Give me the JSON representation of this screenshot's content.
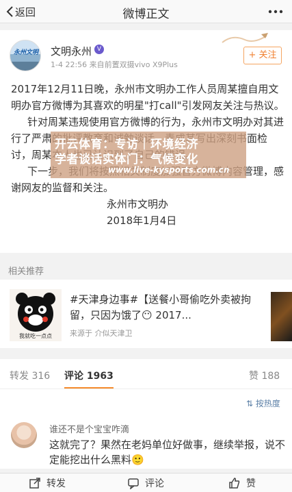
{
  "nav": {
    "back_label": "返回",
    "title": "微博正文"
  },
  "author": {
    "name": "文明永州",
    "avatar_text": "永州文明",
    "verified": "V",
    "meta": "1-4 22:56  来自前置双摄vivo X9Plus",
    "follow_label": "+ 关注"
  },
  "post": {
    "para1": "2017年12月11日晚，永州市文明办工作人员周某擅自用文明办官方微博为其喜欢的明星\"打call\"引发网友关注与热议。",
    "para2": "针对周某违规使用官方微博的行为，永州市文明办对其进行了严肃的批评教育和诚勉谈话，责成其写出深刻书面检讨，周某本人也已认识到了自己的错误。",
    "para3": "下一步，我们将按照相关制度加强官方微博内容管理，感谢网友的监督和关注。",
    "sign": "永州市文明办",
    "date": "2018年1月4日"
  },
  "watermark": {
    "line1": "开云体育：专访｜环境经济",
    "line2": "学者谈话实体门：气候变化",
    "line3": "www.live-kysports.com.cn"
  },
  "related": {
    "section_title": "相关推荐",
    "thumb_caption": "我就吃一点点",
    "text": "#天津身边事#【送餐小哥偷吃外卖被拘留，只因为饿了😶 2017...",
    "source": "来源于  介似天津卫"
  },
  "tabs": {
    "repost": "转发 316",
    "comment": "评论 1963",
    "like": "赞 188"
  },
  "sort_label": "按热度",
  "comment": {
    "name": "谁还不是个宝宝咋滴",
    "text": "这就完了？果然在老妈单位好做事，继续举报，说不定能挖出什么黑料🙂"
  },
  "bottom": {
    "repost": "转发",
    "comment": "评论",
    "like": "赞"
  },
  "colors": {
    "accent": "#f58a2a",
    "link": "#5b7fa6"
  }
}
